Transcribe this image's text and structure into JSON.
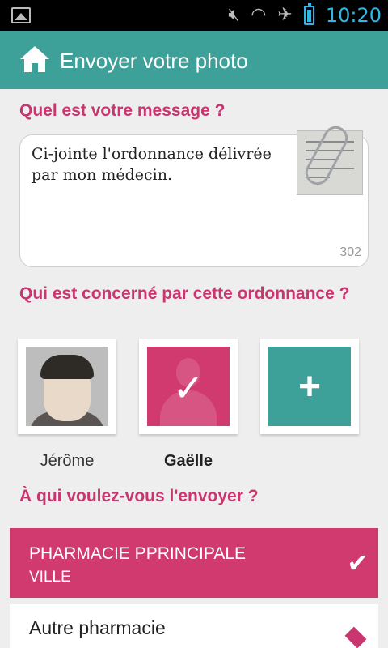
{
  "status_bar": {
    "time": "10:20",
    "icons": [
      "image-notification-icon",
      "mute-icon",
      "wifi-icon",
      "airplane-mode-icon",
      "battery-icon"
    ]
  },
  "app_bar": {
    "title": "Envoyer votre photo",
    "icon": "home-icon"
  },
  "message_section": {
    "title": "Quel est votre message ?",
    "message_value": "Ci-jointe l'ordonnance délivrée par mon médecin.",
    "char_counter": "302"
  },
  "concerned_section": {
    "title": "Qui est concerné par cette ordonnance ?",
    "people": [
      {
        "name": "Jérôme",
        "selected": false
      },
      {
        "name": "Gaëlle",
        "selected": true
      }
    ],
    "add_icon": "plus-icon"
  },
  "send_section": {
    "title": "À qui voulez-vous l'envoyer ?",
    "selected_pharmacy": {
      "name": "PHARMACIE PPRINCIPALE",
      "city": "VILLE"
    },
    "other_pharmacy_label": "Autre pharmacie"
  },
  "colors": {
    "accent_pink": "#c8356f",
    "selected_pink": "#d13a6f",
    "teal": "#3ea199",
    "status_blue": "#33b5e5"
  }
}
